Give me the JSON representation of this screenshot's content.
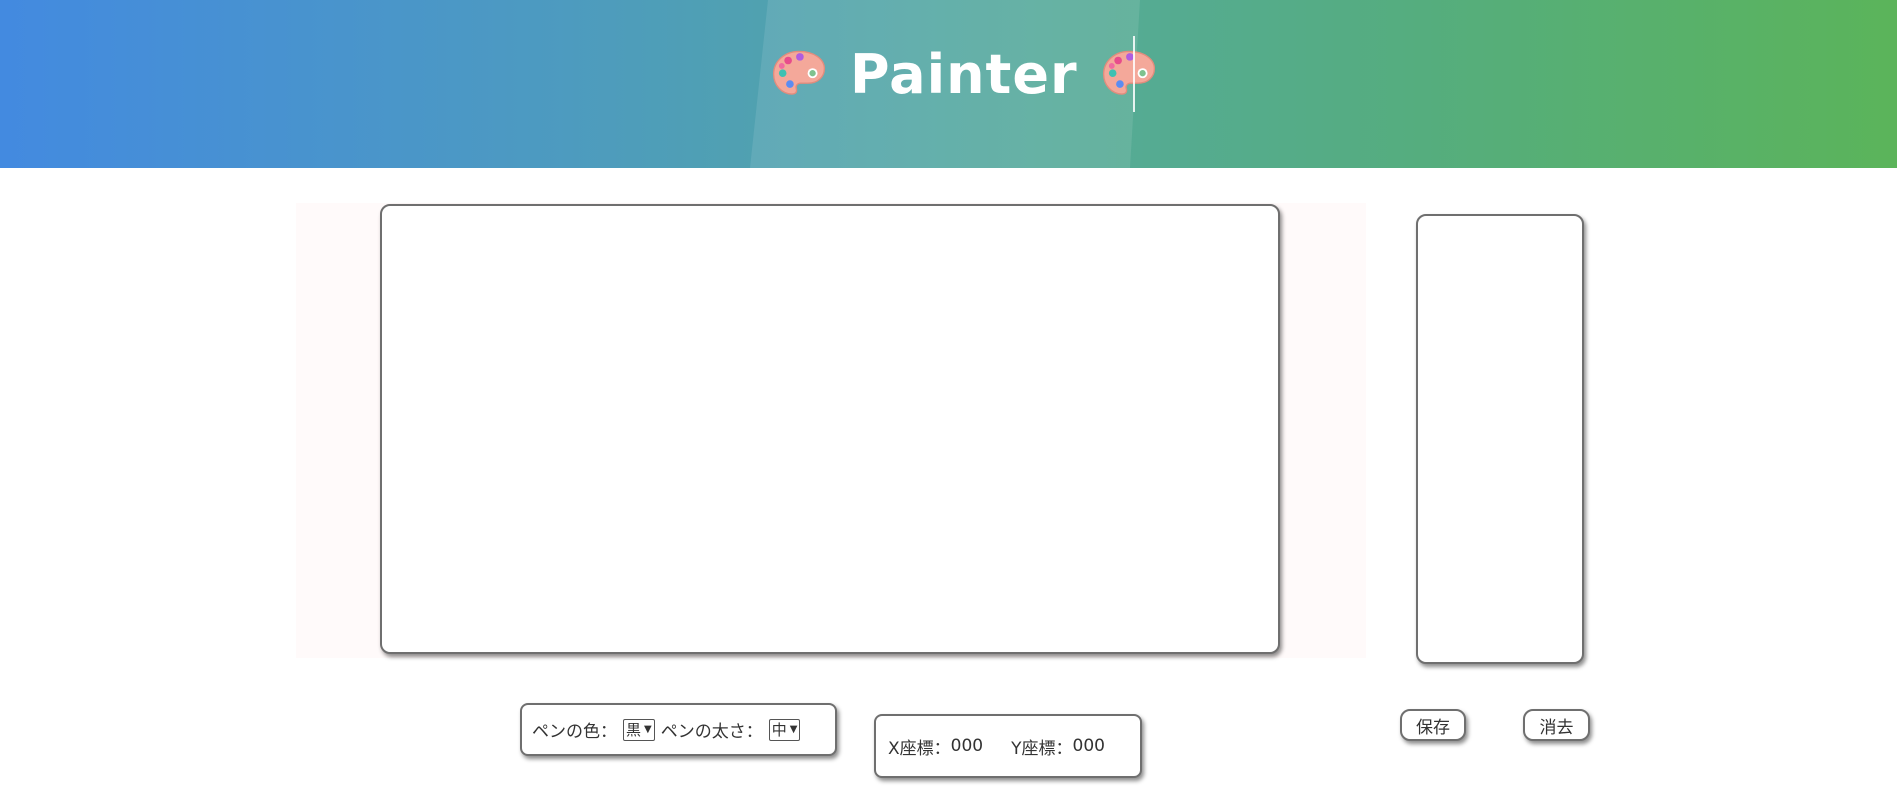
{
  "header": {
    "title": "Painter",
    "left_icon": "palette-icon",
    "right_icon": "palette-icon",
    "gradient": [
      "#438ae0",
      "#55aa9a",
      "#5bb45a"
    ]
  },
  "canvas": {
    "main": "drawing-canvas",
    "side": "preview-panel"
  },
  "controls": {
    "pen_color_label": "ペンの色：",
    "pen_color_value": "黒",
    "pen_width_label": "ペンの太さ：",
    "pen_width_value": "中"
  },
  "coords": {
    "x_label": "X座標：",
    "x_value": "000",
    "y_label": "Y座標：",
    "y_value": "000"
  },
  "buttons": {
    "save": "保存",
    "clear": "消去"
  }
}
